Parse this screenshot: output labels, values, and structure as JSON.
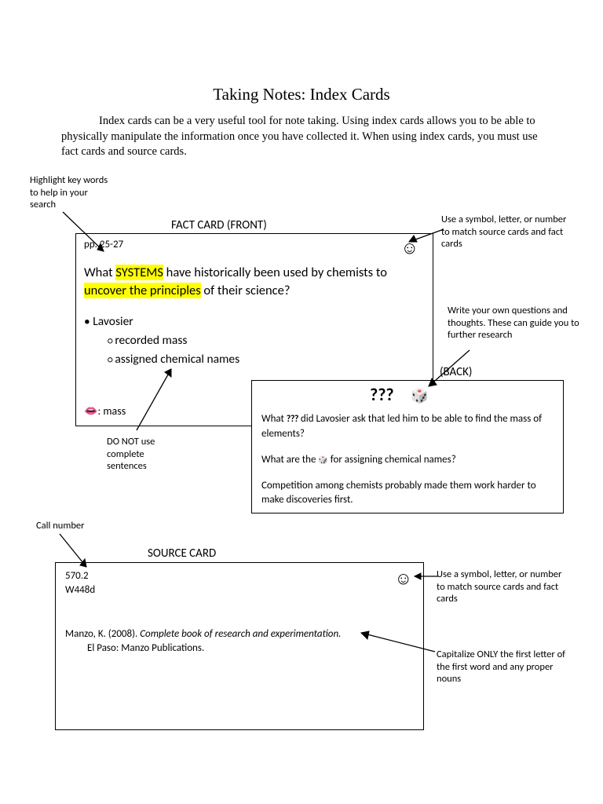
{
  "title": "Taking Notes: Index Cards",
  "intro": "Index cards can be a very useful tool for note taking.  Using index cards allows you to be able to physically manipulate the information once you have collected it.  When using index cards, you must use fact cards and source cards.",
  "ann": {
    "highlight": "Highlight key words to help in your search",
    "symbol1": "Use a symbol, letter, or number to match source cards and fact cards",
    "ownq": "Write your own questions and thoughts.  These can guide you to further research",
    "nosent": "DO NOT use complete sentences",
    "callno": "Call number",
    "symbol2": "Use a symbol, letter, or number to match source cards and fact cards",
    "cap": "Capitalize ONLY the first letter of the first word and any proper nouns"
  },
  "front": {
    "heading": "FACT CARD (FRONT)",
    "pp": "pp. 25-27",
    "q_pre": "What ",
    "q_hl1": "SYSTEMS",
    "q_mid1": " have historically been used by chemists to ",
    "q_hl2": "uncover the principles",
    "q_post": " of their science?",
    "b1": "Lavosier",
    "b2": "recorded mass",
    "b3": "assigned chemical names",
    "eye": ": mass"
  },
  "back": {
    "heading": "(BACK)",
    "p1a": "What ",
    "p1b": " did Lavosier ask that led him to be able to find the mass of elements?",
    "p2a": "What are the ",
    "p2b": " for assigning chemical names?",
    "p3": "Competition among chemists probably made them work harder to make discoveries first."
  },
  "source": {
    "heading": "SOURCE CARD",
    "call1": "570.2",
    "call2": "W448d",
    "cite1a": "Manzo, K. (2008).  ",
    "cite1b": "Complete book of research and experimentation.",
    "cite2": "El Paso: Manzo Publications."
  }
}
